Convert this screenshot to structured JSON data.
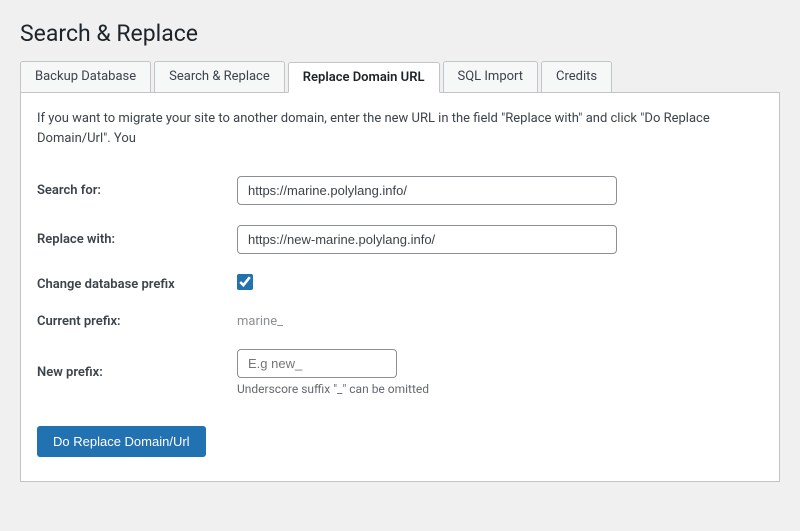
{
  "page": {
    "title": "Search & Replace"
  },
  "tabs": [
    {
      "id": "backup-database",
      "label": "Backup Database",
      "active": false
    },
    {
      "id": "search-replace",
      "label": "Search & Replace",
      "active": false
    },
    {
      "id": "replace-domain-url",
      "label": "Replace Domain URL",
      "active": true
    },
    {
      "id": "sql-import",
      "label": "SQL Import",
      "active": false
    },
    {
      "id": "credits",
      "label": "Credits",
      "active": false
    }
  ],
  "info_text": "If you want to migrate your site to another domain, enter the new URL in the field \"Replace with\" and click \"Do Replace Domain/Url\". You",
  "form": {
    "search_for_label": "Search for:",
    "search_for_value": "https://marine.polylang.info/",
    "replace_with_label": "Replace with:",
    "replace_with_value": "https://new-marine.polylang.info/",
    "change_prefix_label": "Change database prefix",
    "current_prefix_label": "Current prefix:",
    "current_prefix_value": "marine_",
    "new_prefix_label": "New prefix:",
    "new_prefix_placeholder": "E.g new_",
    "hint_text": "Underscore suffix \"_\" can be omitted"
  },
  "submit_button": "Do Replace Domain/Url"
}
